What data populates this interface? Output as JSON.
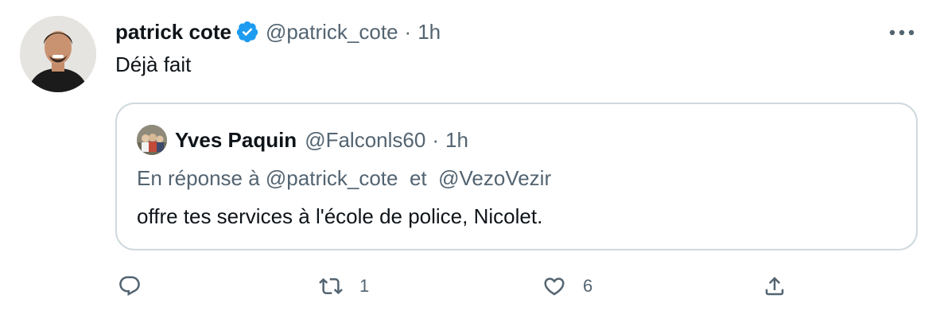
{
  "tweet": {
    "author_name": "patrick cote",
    "author_handle": "@patrick_cote",
    "separator": "·",
    "time": "1h",
    "text": "Déjà fait",
    "verified": true
  },
  "quoted_tweet": {
    "author_name": "Yves Paquin",
    "author_handle": "@Falconls60",
    "separator": "·",
    "time": "1h",
    "reply_prefix": "En réponse à",
    "reply_to_1": "@patrick_cote",
    "reply_joiner": "et",
    "reply_to_2": "@VezoVezir",
    "text": "offre tes services à l'école de police, Nicolet."
  },
  "actions": {
    "reply_count": "",
    "retweet_count": "1",
    "like_count": "6"
  },
  "icons": {
    "verified": "verified-badge-icon",
    "more": "more-horizontal-icon",
    "reply": "reply-icon",
    "retweet": "retweet-icon",
    "like": "heart-icon",
    "share": "share-icon"
  },
  "colors": {
    "text_primary": "#0f1419",
    "text_secondary": "#536471",
    "verified_blue": "#1d9bf0",
    "border": "#cfd9de"
  }
}
